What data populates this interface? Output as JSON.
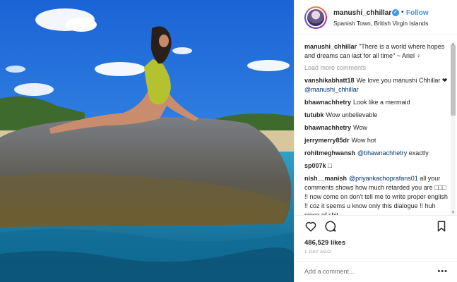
{
  "post": {
    "username": "manushi_chhillar",
    "verified_mark": "✓",
    "dot": "•",
    "follow_label": "Follow",
    "location": "Spanish Town, British Virgin Islands"
  },
  "caption": {
    "username": "manushi_chhillar",
    "text": "\"There is a world where hopes and dreams can last for all time\" ~ Ariel ♀"
  },
  "load_more_label": "Load more comments",
  "comments": [
    {
      "user": "vanshikabhatt18",
      "text": "We love you manushi Chhillar ❤",
      "mention": "@manushi_chhillar"
    },
    {
      "user": "bhawnachhetry",
      "text": "Look like a mermaid",
      "mention": ""
    },
    {
      "user": "tutubk",
      "text": "Wow unbelievable",
      "mention": ""
    },
    {
      "user": "bhawnachhetry",
      "text": "Wow",
      "mention": ""
    },
    {
      "user": "jerrymerry85dr",
      "text": "Wow hot",
      "mention": ""
    },
    {
      "user": "rohitmeghwansh",
      "text": "exactly",
      "mention": "@bhawnachhetry"
    },
    {
      "user": "sp007k",
      "text": "□",
      "mention": ""
    },
    {
      "user": "nish__manish",
      "mention": "@priyankachoprafans01",
      "text": "all your comments shows how much retarded you are □□□ !! now come on don't tell me to write proper english !! coz it seems u know only this dialogue !! huh piece of shit"
    }
  ],
  "actions": {
    "like_icon": "heart-icon",
    "comment_icon": "comment-bubble-icon",
    "save_icon": "bookmark-icon"
  },
  "likes": "486,529 likes",
  "time": "1 DAY AGO",
  "add_comment_placeholder": "Add a comment...",
  "more_label": "•••",
  "colors": {
    "link_blue": "#3897f0",
    "text": "#262626",
    "muted": "#999999",
    "mention": "#003569"
  }
}
